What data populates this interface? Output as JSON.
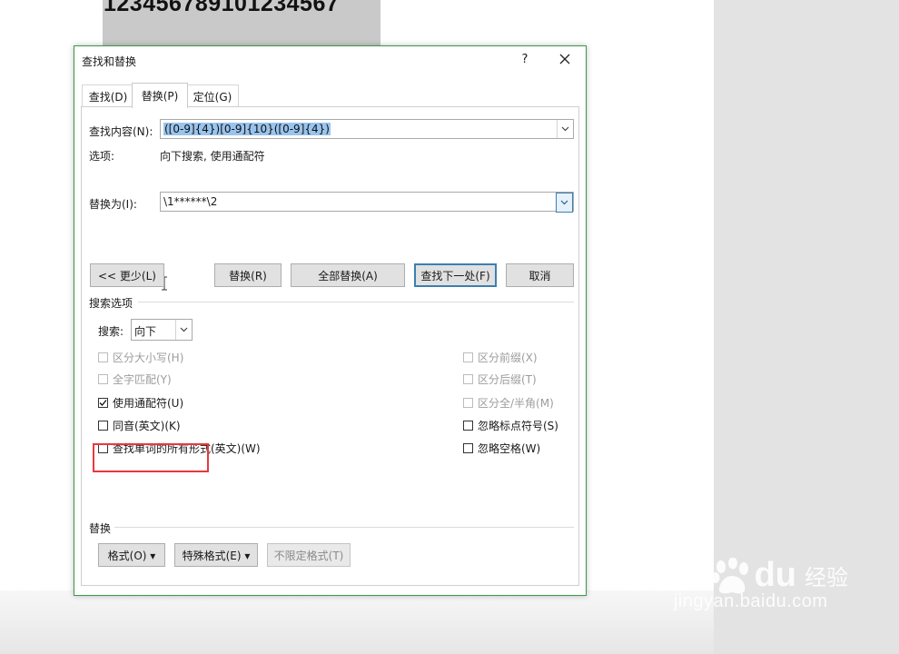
{
  "background": {
    "doc_number": "12345678910123456​7"
  },
  "dialog": {
    "title": "查找和替换",
    "help": "?",
    "tabs": [
      {
        "label": "查找(D)"
      },
      {
        "label": "替换(P)"
      },
      {
        "label": "定位(G)"
      }
    ],
    "find": {
      "label": "查找内容(N):",
      "value": "([0-9]{4})[0-9]{10}([0-9]{4})",
      "options_label": "选项:",
      "options_value": "向下搜索, 使用通配符"
    },
    "replace": {
      "label": "替换为(I):",
      "value": "\\1******\\2"
    },
    "buttons": {
      "less": "<< 更少(L)",
      "replace": "替换(R)",
      "replace_all": "全部替换(A)",
      "find_next": "查找下一处(F)",
      "cancel": "取消"
    },
    "search_options": {
      "heading": "搜索选项",
      "search_label": "搜索:",
      "search_value": "向下",
      "left_checks": [
        {
          "label": "区分大小写(H)",
          "checked": false,
          "enabled": false
        },
        {
          "label": "全字匹配(Y)",
          "checked": false,
          "enabled": false
        },
        {
          "label": "使用通配符(U)",
          "checked": true,
          "enabled": true
        },
        {
          "label": "同音(英文)(K)",
          "checked": false,
          "enabled": true
        },
        {
          "label": "查找单词的所有形式(英文)(W)",
          "checked": false,
          "enabled": true
        }
      ],
      "right_checks": [
        {
          "label": "区分前缀(X)",
          "checked": false,
          "enabled": false
        },
        {
          "label": "区分后缀(T)",
          "checked": false,
          "enabled": false
        },
        {
          "label": "区分全/半角(M)",
          "checked": false,
          "enabled": false
        },
        {
          "label": "忽略标点符号(S)",
          "checked": false,
          "enabled": true
        },
        {
          "label": "忽略空格(W)",
          "checked": false,
          "enabled": true
        }
      ]
    },
    "replace_section": {
      "heading": "替换",
      "format": "格式(O) ▾",
      "special": "特殊格式(E) ▾",
      "no_format": "不限定格式(T)"
    }
  },
  "watermark": {
    "brand_left": "Bai",
    "brand_right": "du",
    "brand_cn": "经验",
    "url": "jingyan.baidu.com"
  },
  "colors": {
    "dialog_border": "#3a9a45",
    "selection": "#99c4ee",
    "highlight_box": "#e8383d",
    "default_button_border": "#3c7fb1"
  }
}
